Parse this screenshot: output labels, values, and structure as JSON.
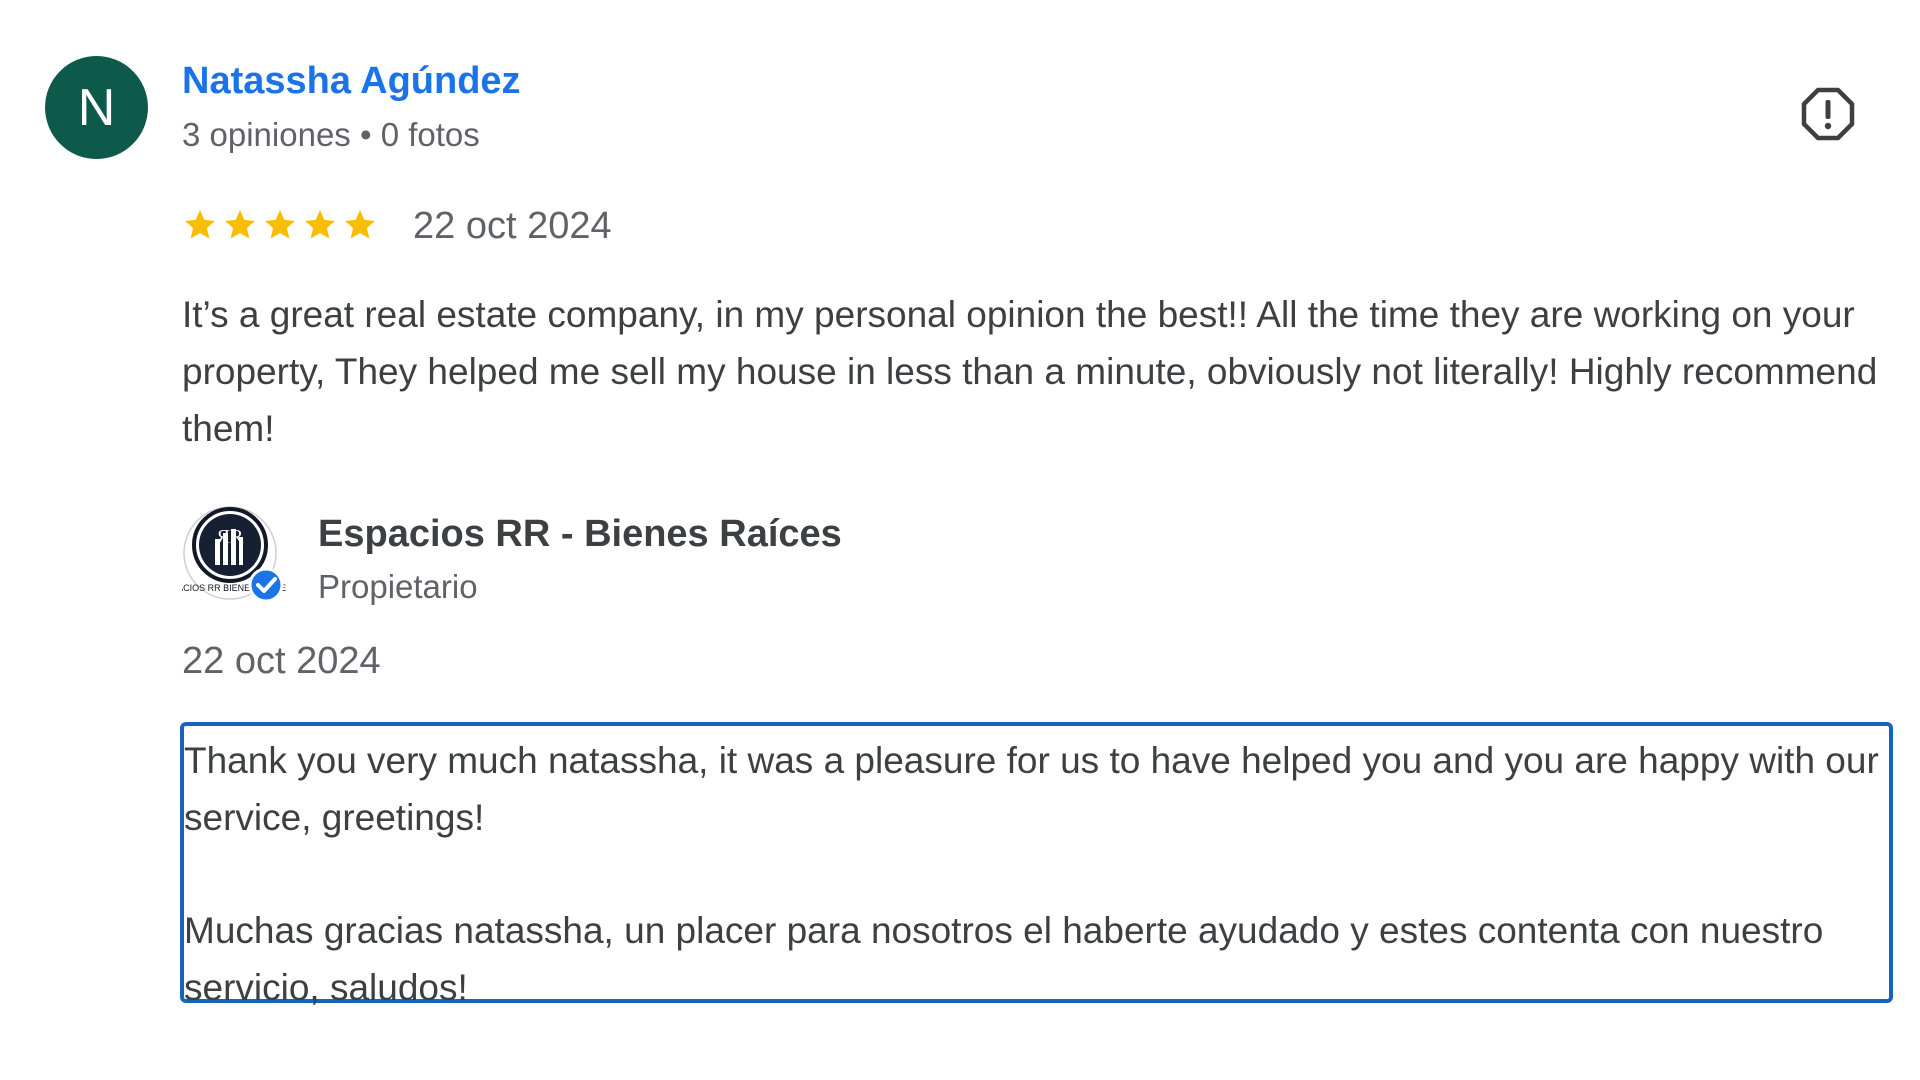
{
  "reviewer": {
    "initial": "N",
    "name": "Natassha Agúndez",
    "meta": "3 opiniones • 0 fotos",
    "avatar_color": "#0e5a4a",
    "name_color": "#1a73e8"
  },
  "review": {
    "rating": 5,
    "rating_max": 5,
    "star_color": "#fbbc04",
    "date": "22 oct 2024",
    "text": "It’s a great real estate company, in my personal opinion the best!! All the time they are working on your property, They helped me sell my house in less than a minute, obviously not literally! Highly recommend them!",
    "report_icon": "report-icon"
  },
  "owner_reply": {
    "owner_name": "Espacios RR - Bienes Raíces",
    "owner_role": "Propietario",
    "verified_icon": "verified-check-icon",
    "logo_icon": "espacios-rr-logo",
    "logo_text": "ESPACIOS RR BIENES RAICES",
    "date": "22 oct 2024",
    "paragraphs": [
      "Thank you very much natassha, it was a pleasure for us to have helped you and you are happy with our service, greetings!",
      "Muchas gracias natassha, un placer para nosotros el haberte ayudado y estes contenta con nuestro servicio, saludos!"
    ],
    "highlight_color": "#1565c0"
  }
}
